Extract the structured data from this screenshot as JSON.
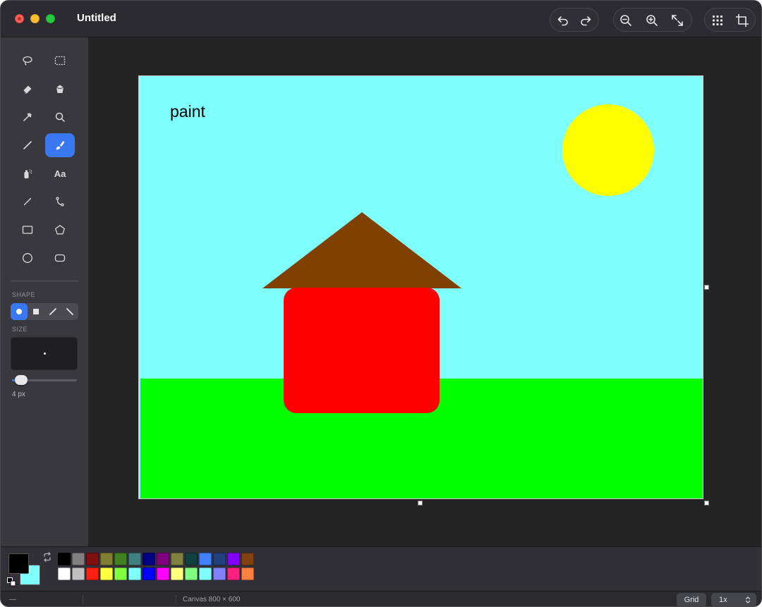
{
  "window": {
    "title": "Untitled"
  },
  "toolbar": {
    "undo_icon": "undo-icon",
    "redo_icon": "redo-icon",
    "zoom_out_icon": "zoom-out-icon",
    "zoom_in_icon": "zoom-in-icon",
    "fit_icon": "expand-icon",
    "grid_icon": "grid-icon",
    "crop_icon": "crop-icon"
  },
  "tools": [
    {
      "name": "lasso-select",
      "icon": "lasso-icon"
    },
    {
      "name": "rect-select",
      "icon": "dashed-rect-icon"
    },
    {
      "name": "eraser",
      "icon": "eraser-icon"
    },
    {
      "name": "fill",
      "icon": "bucket-icon"
    },
    {
      "name": "color-picker",
      "icon": "eyedropper-icon"
    },
    {
      "name": "magnifier",
      "icon": "magnifier-icon"
    },
    {
      "name": "pencil",
      "icon": "pencil-icon"
    },
    {
      "name": "brush",
      "icon": "brush-icon",
      "active": true
    },
    {
      "name": "airbrush",
      "icon": "spray-icon"
    },
    {
      "name": "text",
      "icon": "text-icon",
      "label": "Aa"
    },
    {
      "name": "line",
      "icon": "line-icon"
    },
    {
      "name": "curve",
      "icon": "curve-icon"
    },
    {
      "name": "rectangle",
      "icon": "rectangle-icon"
    },
    {
      "name": "polygon",
      "icon": "pentagon-icon"
    },
    {
      "name": "ellipse",
      "icon": "circle-icon"
    },
    {
      "name": "rounded-rectangle",
      "icon": "rounded-rect-icon"
    }
  ],
  "sidebar": {
    "shape_label": "SHAPE",
    "shape_options": [
      {
        "name": "circle",
        "active": true
      },
      {
        "name": "square",
        "active": false
      },
      {
        "name": "slash-forward",
        "active": false
      },
      {
        "name": "slash-back",
        "active": false
      }
    ],
    "size_label": "SIZE",
    "size_value": "4 px",
    "size_slider_fraction": 0.1
  },
  "canvas": {
    "text": "paint",
    "colors": {
      "sky": "#80ffff",
      "grass": "#00ff00",
      "sun": "#ffff00",
      "roof": "#804000",
      "house": "#ff0000"
    }
  },
  "palette": {
    "foreground": "#000000",
    "background": "#80ffff",
    "swap_icon": "swap-icon",
    "row1": [
      "#000000",
      "#808080",
      "#801010",
      "#808030",
      "#408020",
      "#408080",
      "#000080",
      "#800080",
      "#808040",
      "#104040",
      "#4080ff",
      "#204080",
      "#8000ff",
      "#804010"
    ],
    "row2": [
      "#ffffff",
      "#c0c0c0",
      "#ff2010",
      "#ffff40",
      "#80ff40",
      "#80ffff",
      "#0000ff",
      "#ff00ff",
      "#ffff80",
      "#80ff80",
      "#80ffff",
      "#8080ff",
      "#ff2080",
      "#ff8040"
    ]
  },
  "status": {
    "left": "—",
    "canvas_size": "Canvas 800 × 600",
    "grid_label": "Grid",
    "zoom": "1x"
  }
}
